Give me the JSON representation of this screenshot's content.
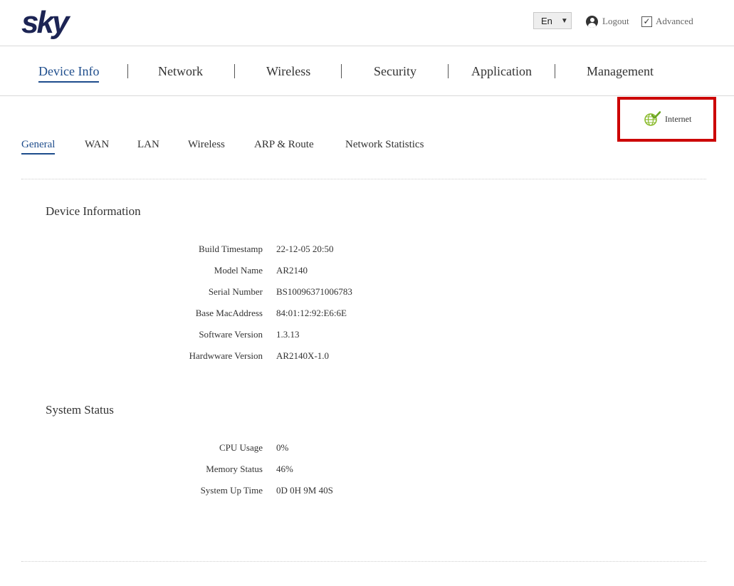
{
  "header": {
    "logo_text": "sky",
    "language": "En",
    "logout_label": "Logout",
    "advanced_label": "Advanced",
    "advanced_checked": true
  },
  "main_nav": {
    "items": [
      {
        "label": "Device Info",
        "active": true
      },
      {
        "label": "Network",
        "active": false
      },
      {
        "label": "Wireless",
        "active": false
      },
      {
        "label": "Security",
        "active": false
      },
      {
        "label": "Application",
        "active": false
      },
      {
        "label": "Management",
        "active": false
      }
    ]
  },
  "internet_status": {
    "label": "Internet",
    "icon": "globe-check-icon",
    "highlight_color": "#cc0000",
    "icon_color": "#8bbb2e"
  },
  "sub_tabs": {
    "items": [
      {
        "label": "General",
        "active": true
      },
      {
        "label": "WAN",
        "active": false
      },
      {
        "label": "LAN",
        "active": false
      },
      {
        "label": "Wireless",
        "active": false
      },
      {
        "label": "ARP & Route",
        "active": false
      },
      {
        "label": "Network Statistics",
        "active": false
      }
    ]
  },
  "device_information": {
    "title": "Device Information",
    "rows": [
      {
        "label": "Build Timestamp",
        "value": "22-12-05 20:50"
      },
      {
        "label": "Model Name",
        "value": "AR2140"
      },
      {
        "label": "Serial Number",
        "value": "BS10096371006783"
      },
      {
        "label": "Base MacAddress",
        "value": "84:01:12:92:E6:6E"
      },
      {
        "label": "Software Version",
        "value": "1.3.13"
      },
      {
        "label": "Hardwware Version",
        "value": "AR2140X-1.0"
      }
    ]
  },
  "system_status": {
    "title": "System Status",
    "rows": [
      {
        "label": "CPU Usage",
        "value": "0%"
      },
      {
        "label": "Memory Status",
        "value": "46%"
      },
      {
        "label": "System Up Time",
        "value": "0D 0H 9M 40S"
      }
    ]
  },
  "colors": {
    "brand": "#1c2454",
    "accent": "#1e4d8c"
  }
}
